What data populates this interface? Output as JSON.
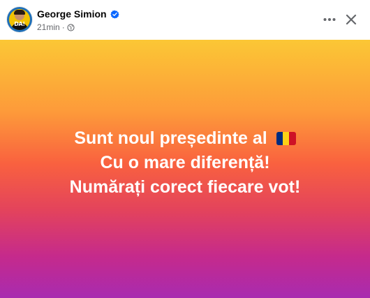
{
  "post": {
    "author": "George Simion",
    "avatar_text": "DA!",
    "time": "21min",
    "separator": "·",
    "audience_icon": "globe-icon",
    "verified_icon": "verified-badge-icon",
    "lines": [
      "Sunt noul președinte al",
      "Cu o mare diferență!",
      "Numărați corect fiecare vot!"
    ],
    "flag": "Romania",
    "flag_colors": [
      "#002b7f",
      "#fcd116",
      "#ce1126"
    ]
  },
  "actions": {
    "more_icon": "more-options-icon",
    "close_icon": "close-icon"
  },
  "colors": {
    "gradient": [
      "#fbc735",
      "#fd9a3a",
      "#f9613f",
      "#e3435c",
      "#c52a8c",
      "#a82bb0"
    ],
    "verified": "#0866ff"
  }
}
